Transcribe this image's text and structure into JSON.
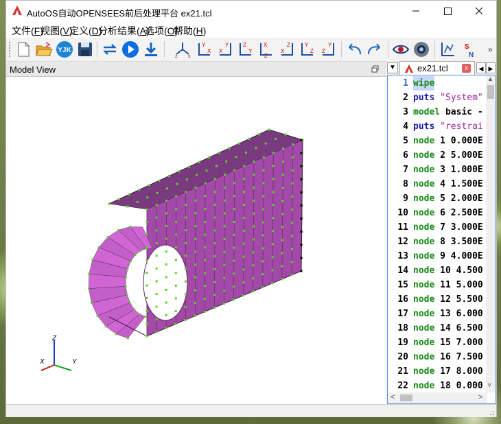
{
  "window": {
    "title": "AutoOS自动OPENSEES前后处理平台 ex21.tcl",
    "minimize_glyph": "—",
    "maximize_glyph": "☐",
    "close_glyph": "✕"
  },
  "menu": [
    {
      "label": "文件",
      "hotkey": "F"
    },
    {
      "label": "视图",
      "hotkey": "V"
    },
    {
      "label": "定义",
      "hotkey": "D"
    },
    {
      "label": "分析结果",
      "hotkey": "A"
    },
    {
      "label": "选项",
      "hotkey": "O"
    },
    {
      "label": "帮助",
      "hotkey": "H"
    }
  ],
  "toolbar": {
    "icons": [
      "new-file-icon",
      "open-folder-icon",
      "yjk-import-icon",
      "save-icon",
      "refresh-icon",
      "run-icon",
      "download-icon",
      "view-3d-icon",
      "view-xy-icon",
      "view-yx-icon",
      "view-zy-icon",
      "view-zx-icon",
      "view-xz-icon",
      "view-yz-icon",
      "view-zy2-icon",
      "undo-icon",
      "redo-icon",
      "eye-icon",
      "camera-icon",
      "chart-icon",
      "sn-icon"
    ],
    "overflow_glyph": "»",
    "yjk_label": "YJK",
    "sn_label_s": "S",
    "sn_label_n": "N"
  },
  "model_view": {
    "title": "Model View",
    "axes": {
      "x": "X",
      "y": "Y",
      "z": "Z"
    },
    "colors": {
      "face": "#c35fc8",
      "dark": "#6a2f6e",
      "node": "#5ad12a"
    }
  },
  "editor": {
    "tab_label": "ex21.tcl",
    "tab_close": "x",
    "nav_glyphs": {
      "left": "◀",
      "right": "▶",
      "down": "▼",
      "scroll_up": "▲",
      "scroll_down": "˅",
      "scroll_left": "<",
      "scroll_right": ">"
    },
    "lines": [
      {
        "n": "1",
        "parts": [
          {
            "t": "wipe",
            "c": "node-kw"
          }
        ]
      },
      {
        "n": "2",
        "parts": [
          {
            "t": "puts",
            "c": "kw"
          },
          {
            "t": " \"System\"",
            "c": "str"
          }
        ]
      },
      {
        "n": "3",
        "parts": [
          {
            "t": "model",
            "c": "mdl-kw"
          },
          {
            "t": " basic -",
            "c": "plain"
          }
        ]
      },
      {
        "n": "4",
        "parts": [
          {
            "t": "puts",
            "c": "kw"
          },
          {
            "t": " \"restrai",
            "c": "str"
          }
        ]
      },
      {
        "n": "5",
        "parts": [
          {
            "t": "node",
            "c": "node-kw"
          },
          {
            "t": " 1 0.000E",
            "c": "plain"
          }
        ]
      },
      {
        "n": "6",
        "parts": [
          {
            "t": "node",
            "c": "node-kw"
          },
          {
            "t": " 2 5.000E",
            "c": "plain"
          }
        ]
      },
      {
        "n": "7",
        "parts": [
          {
            "t": "node",
            "c": "node-kw"
          },
          {
            "t": " 3 1.000E",
            "c": "plain"
          }
        ]
      },
      {
        "n": "8",
        "parts": [
          {
            "t": "node",
            "c": "node-kw"
          },
          {
            "t": " 4 1.500E",
            "c": "plain"
          }
        ]
      },
      {
        "n": "9",
        "parts": [
          {
            "t": "node",
            "c": "node-kw"
          },
          {
            "t": " 5 2.000E",
            "c": "plain"
          }
        ]
      },
      {
        "n": "10",
        "parts": [
          {
            "t": "node",
            "c": "node-kw"
          },
          {
            "t": " 6 2.500E",
            "c": "plain"
          }
        ]
      },
      {
        "n": "11",
        "parts": [
          {
            "t": "node",
            "c": "node-kw"
          },
          {
            "t": " 7 3.000E",
            "c": "plain"
          }
        ]
      },
      {
        "n": "12",
        "parts": [
          {
            "t": "node",
            "c": "node-kw"
          },
          {
            "t": " 8 3.500E",
            "c": "plain"
          }
        ]
      },
      {
        "n": "13",
        "parts": [
          {
            "t": "node",
            "c": "node-kw"
          },
          {
            "t": " 9 4.000E",
            "c": "plain"
          }
        ]
      },
      {
        "n": "14",
        "parts": [
          {
            "t": "node",
            "c": "node-kw"
          },
          {
            "t": " 10 4.500",
            "c": "plain"
          }
        ]
      },
      {
        "n": "15",
        "parts": [
          {
            "t": "node",
            "c": "node-kw"
          },
          {
            "t": " 11 5.000",
            "c": "plain"
          }
        ]
      },
      {
        "n": "16",
        "parts": [
          {
            "t": "node",
            "c": "node-kw"
          },
          {
            "t": " 12 5.500",
            "c": "plain"
          }
        ]
      },
      {
        "n": "17",
        "parts": [
          {
            "t": "node",
            "c": "node-kw"
          },
          {
            "t": " 13 6.000",
            "c": "plain"
          }
        ]
      },
      {
        "n": "18",
        "parts": [
          {
            "t": "node",
            "c": "node-kw"
          },
          {
            "t": " 14 6.500",
            "c": "plain"
          }
        ]
      },
      {
        "n": "19",
        "parts": [
          {
            "t": "node",
            "c": "node-kw"
          },
          {
            "t": " 15 7.000",
            "c": "plain"
          }
        ]
      },
      {
        "n": "20",
        "parts": [
          {
            "t": "node",
            "c": "node-kw"
          },
          {
            "t": " 16 7.500",
            "c": "plain"
          }
        ]
      },
      {
        "n": "21",
        "parts": [
          {
            "t": "node",
            "c": "node-kw"
          },
          {
            "t": " 17 8.000",
            "c": "plain"
          }
        ]
      },
      {
        "n": "22",
        "parts": [
          {
            "t": "node",
            "c": "node-kw"
          },
          {
            "t": " 18 0.000",
            "c": "plain"
          }
        ]
      }
    ]
  }
}
